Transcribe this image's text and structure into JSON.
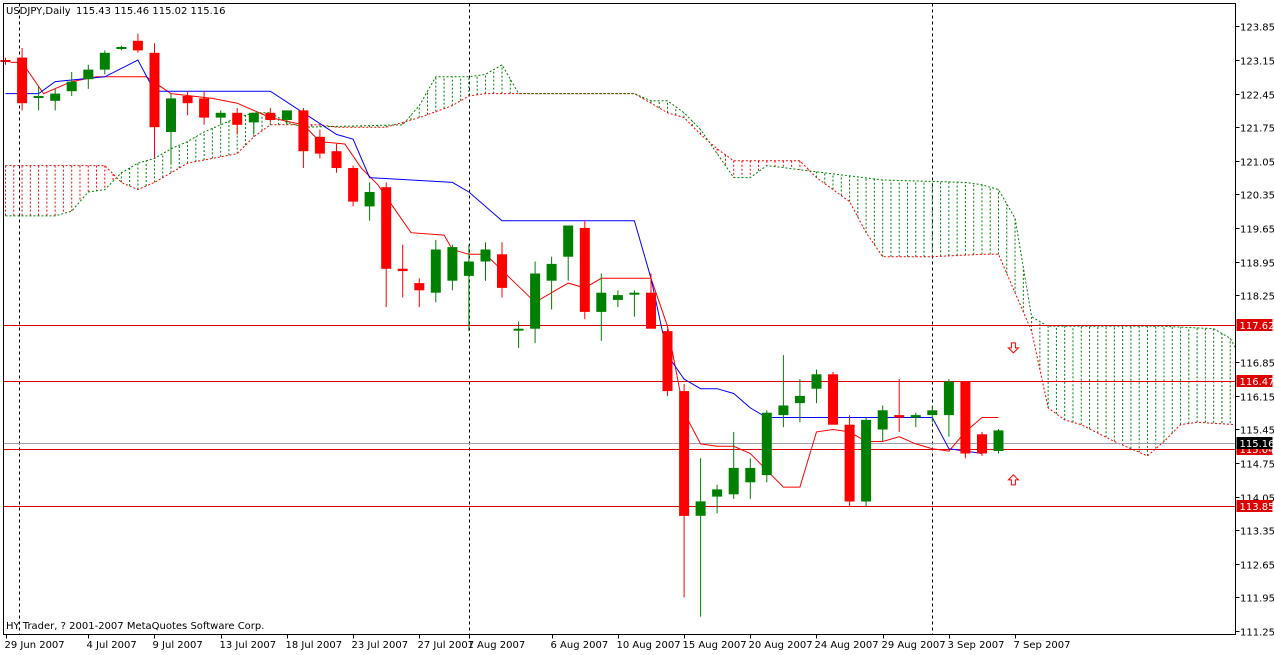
{
  "window": {
    "title_symbol": "USDJPY,Daily",
    "title_ohlc": "115.43 115.46 115.02 115.16",
    "copyright": "HY Trader, ? 2001-2007 MetaQuotes Software Corp."
  },
  "colors": {
    "background": "#ffffff",
    "bull_candle": "#008000",
    "bear_candle": "#ff0000",
    "tenkan": "#ff0000",
    "kijun": "#0000ff",
    "cloud_span_a": "#ff0000",
    "cloud_span_b": "#008000",
    "level_line": "#dd0000",
    "bid_line": "#a0a0b4",
    "price_tag_bg": "#dd0000",
    "bid_tag_bg": "#000000"
  },
  "chart_data": {
    "type": "candlestick",
    "symbol": "USDJPY",
    "timeframe": "Daily",
    "ylim": [
      111.1,
      124.15
    ],
    "y_ticks": [
      "123.85",
      "123.15",
      "122.45",
      "121.75",
      "121.05",
      "120.35",
      "119.65",
      "118.95",
      "118.25",
      "116.85",
      "116.15",
      "115.45",
      "114.75",
      "114.05",
      "113.35",
      "112.65",
      "111.95",
      "111.25"
    ],
    "x_tick_labels": [
      {
        "label": "29 Jun 2007",
        "bar": 0
      },
      {
        "label": "4 Jul 2007",
        "bar": 5
      },
      {
        "label": "9 Jul 2007",
        "bar": 9
      },
      {
        "label": "13 Jul 2007",
        "bar": 13
      },
      {
        "label": "18 Jul 2007",
        "bar": 17
      },
      {
        "label": "23 Jul 2007",
        "bar": 21
      },
      {
        "label": "27 Jul 2007",
        "bar": 25
      },
      {
        "label": "1 Aug 2007",
        "bar": 28
      },
      {
        "label": "6 Aug 2007",
        "bar": 33
      },
      {
        "label": "10 Aug 2007",
        "bar": 37
      },
      {
        "label": "15 Aug 2007",
        "bar": 41
      },
      {
        "label": "20 Aug 2007",
        "bar": 45
      },
      {
        "label": "24 Aug 2007",
        "bar": 49
      },
      {
        "label": "29 Aug 2007",
        "bar": 53
      },
      {
        "label": "3 Sep 2007",
        "bar": 57
      },
      {
        "label": "7 Sep 2007",
        "bar": 61
      }
    ],
    "period_separators_bar": [
      0.8,
      28,
      56
    ],
    "candles": [
      {
        "o": 123.15,
        "h": 123.2,
        "l": 123.05,
        "c": 123.12
      },
      {
        "o": 123.2,
        "h": 123.4,
        "l": 122.1,
        "c": 122.25
      },
      {
        "o": 122.4,
        "h": 122.6,
        "l": 122.1,
        "c": 122.4
      },
      {
        "o": 122.3,
        "h": 122.55,
        "l": 122.1,
        "c": 122.45
      },
      {
        "o": 122.5,
        "h": 122.9,
        "l": 122.4,
        "c": 122.7
      },
      {
        "o": 122.75,
        "h": 123.05,
        "l": 122.55,
        "c": 122.95
      },
      {
        "o": 122.95,
        "h": 123.35,
        "l": 122.85,
        "c": 123.3
      },
      {
        "o": 123.4,
        "h": 123.45,
        "l": 123.35,
        "c": 123.42
      },
      {
        "o": 123.55,
        "h": 123.7,
        "l": 123.3,
        "c": 123.35
      },
      {
        "o": 123.3,
        "h": 123.5,
        "l": 121.1,
        "c": 121.75
      },
      {
        "o": 121.65,
        "h": 122.45,
        "l": 121.0,
        "c": 122.35
      },
      {
        "o": 122.4,
        "h": 122.5,
        "l": 122.0,
        "c": 122.25
      },
      {
        "o": 122.35,
        "h": 122.5,
        "l": 121.8,
        "c": 121.95
      },
      {
        "o": 121.95,
        "h": 122.1,
        "l": 121.8,
        "c": 122.05
      },
      {
        "o": 122.05,
        "h": 122.15,
        "l": 121.6,
        "c": 121.8
      },
      {
        "o": 121.85,
        "h": 122.05,
        "l": 121.6,
        "c": 122.05
      },
      {
        "o": 122.05,
        "h": 122.15,
        "l": 121.85,
        "c": 121.9
      },
      {
        "o": 121.9,
        "h": 122.1,
        "l": 121.8,
        "c": 122.1
      },
      {
        "o": 122.1,
        "h": 122.15,
        "l": 120.9,
        "c": 121.25
      },
      {
        "o": 121.55,
        "h": 121.7,
        "l": 121.1,
        "c": 121.2
      },
      {
        "o": 121.25,
        "h": 121.4,
        "l": 120.8,
        "c": 120.9
      },
      {
        "o": 120.9,
        "h": 120.95,
        "l": 120.1,
        "c": 120.2
      },
      {
        "o": 120.1,
        "h": 120.6,
        "l": 119.8,
        "c": 120.4
      },
      {
        "o": 120.5,
        "h": 120.6,
        "l": 118.0,
        "c": 118.8
      },
      {
        "o": 118.8,
        "h": 119.3,
        "l": 118.2,
        "c": 118.75
      },
      {
        "o": 118.5,
        "h": 118.6,
        "l": 118.0,
        "c": 118.35
      },
      {
        "o": 118.3,
        "h": 119.4,
        "l": 118.1,
        "c": 119.2
      },
      {
        "o": 118.55,
        "h": 119.3,
        "l": 118.35,
        "c": 119.25
      },
      {
        "o": 118.65,
        "h": 119.3,
        "l": 117.5,
        "c": 118.95
      },
      {
        "o": 118.95,
        "h": 119.35,
        "l": 118.55,
        "c": 119.2
      },
      {
        "o": 119.1,
        "h": 119.35,
        "l": 118.2,
        "c": 118.4
      },
      {
        "o": 117.55,
        "h": 117.7,
        "l": 117.15,
        "c": 117.55
      },
      {
        "o": 117.55,
        "h": 118.95,
        "l": 117.25,
        "c": 118.7
      },
      {
        "o": 118.55,
        "h": 119.05,
        "l": 117.95,
        "c": 118.9
      },
      {
        "o": 119.05,
        "h": 119.7,
        "l": 118.55,
        "c": 119.7
      },
      {
        "o": 119.65,
        "h": 119.8,
        "l": 117.75,
        "c": 117.9
      },
      {
        "o": 117.9,
        "h": 118.7,
        "l": 117.3,
        "c": 118.3
      },
      {
        "o": 118.15,
        "h": 118.35,
        "l": 118.0,
        "c": 118.25
      },
      {
        "o": 118.3,
        "h": 118.35,
        "l": 117.8,
        "c": 118.3
      },
      {
        "o": 118.3,
        "h": 118.7,
        "l": 117.6,
        "c": 117.55
      },
      {
        "o": 117.5,
        "h": 117.55,
        "l": 116.15,
        "c": 116.25
      },
      {
        "o": 116.25,
        "h": 116.4,
        "l": 111.95,
        "c": 113.65
      },
      {
        "o": 113.65,
        "h": 114.85,
        "l": 111.55,
        "c": 113.95
      },
      {
        "o": 114.05,
        "h": 114.3,
        "l": 113.7,
        "c": 114.2
      },
      {
        "o": 114.1,
        "h": 115.4,
        "l": 114.0,
        "c": 114.65
      },
      {
        "o": 114.35,
        "h": 114.85,
        "l": 114.0,
        "c": 114.65
      },
      {
        "o": 114.5,
        "h": 115.85,
        "l": 114.35,
        "c": 115.8
      },
      {
        "o": 115.75,
        "h": 117.0,
        "l": 115.5,
        "c": 115.95
      },
      {
        "o": 116.0,
        "h": 116.5,
        "l": 115.6,
        "c": 116.15
      },
      {
        "o": 116.3,
        "h": 116.7,
        "l": 116.0,
        "c": 116.6
      },
      {
        "o": 116.6,
        "h": 116.65,
        "l": 115.6,
        "c": 115.55
      },
      {
        "o": 115.55,
        "h": 115.75,
        "l": 113.85,
        "c": 113.95
      },
      {
        "o": 113.95,
        "h": 115.7,
        "l": 113.85,
        "c": 115.65
      },
      {
        "o": 115.45,
        "h": 115.95,
        "l": 115.2,
        "c": 115.85
      },
      {
        "o": 115.75,
        "h": 116.5,
        "l": 115.4,
        "c": 115.7
      },
      {
        "o": 115.7,
        "h": 115.8,
        "l": 115.5,
        "c": 115.75
      },
      {
        "o": 115.75,
        "h": 115.95,
        "l": 115.6,
        "c": 115.85
      },
      {
        "o": 115.75,
        "h": 116.5,
        "l": 115.3,
        "c": 116.45
      },
      {
        "o": 116.45,
        "h": 116.45,
        "l": 114.85,
        "c": 114.95
      },
      {
        "o": 115.35,
        "h": 115.4,
        "l": 114.9,
        "c": 114.95
      },
      {
        "o": 115.0,
        "h": 115.46,
        "l": 114.95,
        "c": 115.43
      }
    ],
    "tenkan": [
      [
        0.3,
        123.1
      ],
      [
        1,
        123.1
      ],
      [
        2.3,
        122.45
      ],
      [
        4,
        122.7
      ],
      [
        5.5,
        122.8
      ],
      [
        8.5,
        122.8
      ],
      [
        10,
        122.45
      ],
      [
        12.5,
        122.35
      ],
      [
        14,
        122.25
      ],
      [
        16,
        121.95
      ],
      [
        18,
        121.8
      ],
      [
        19,
        121.45
      ],
      [
        20.5,
        121.4
      ],
      [
        21.5,
        120.9
      ],
      [
        22.5,
        120.55
      ],
      [
        23.5,
        120.05
      ],
      [
        24.5,
        119.55
      ],
      [
        26.5,
        119.5
      ],
      [
        27,
        119.2
      ],
      [
        28,
        119.1
      ],
      [
        29,
        119.1
      ],
      [
        30.5,
        118.6
      ],
      [
        32,
        118.1
      ],
      [
        33,
        118.3
      ],
      [
        34,
        118.5
      ],
      [
        35,
        118.4
      ],
      [
        36,
        118.6
      ],
      [
        38,
        118.6
      ],
      [
        39,
        118.6
      ],
      [
        40,
        117.6
      ],
      [
        41,
        115.8
      ],
      [
        42,
        115.15
      ],
      [
        43,
        115.1
      ],
      [
        44,
        115.1
      ],
      [
        45,
        114.95
      ],
      [
        46,
        114.6
      ],
      [
        47,
        114.25
      ],
      [
        48,
        114.25
      ],
      [
        49,
        115.4
      ],
      [
        50,
        115.45
      ],
      [
        51,
        115.4
      ],
      [
        52,
        115.2
      ],
      [
        53,
        115.2
      ],
      [
        54,
        115.3
      ],
      [
        55,
        115.15
      ],
      [
        56,
        115.05
      ],
      [
        57,
        115.0
      ],
      [
        58,
        115.4
      ],
      [
        59,
        115.7
      ],
      [
        60,
        115.7
      ]
    ],
    "kijun": [
      [
        0,
        122.45
      ],
      [
        2,
        122.45
      ],
      [
        3,
        122.7
      ],
      [
        6,
        122.8
      ],
      [
        8,
        123.15
      ],
      [
        9,
        122.5
      ],
      [
        16,
        122.5
      ],
      [
        18,
        122.05
      ],
      [
        20,
        121.6
      ],
      [
        21,
        121.5
      ],
      [
        22,
        120.7
      ],
      [
        27,
        120.6
      ],
      [
        28,
        120.4
      ],
      [
        30,
        119.8
      ],
      [
        33,
        119.8
      ],
      [
        34,
        119.8
      ],
      [
        38,
        119.8
      ],
      [
        39,
        118.6
      ],
      [
        40,
        117.0
      ],
      [
        41,
        116.5
      ],
      [
        42,
        116.3
      ],
      [
        43,
        116.3
      ],
      [
        44,
        116.2
      ],
      [
        45,
        115.9
      ],
      [
        46,
        115.7
      ],
      [
        53,
        115.7
      ],
      [
        56,
        115.7
      ],
      [
        57,
        115.05
      ],
      [
        58,
        115.0
      ],
      [
        59,
        114.95
      ]
    ],
    "senkou_a": [
      [
        0,
        120.95
      ],
      [
        6,
        120.95
      ],
      [
        7,
        120.6
      ],
      [
        8,
        120.45
      ],
      [
        9,
        120.6
      ],
      [
        10,
        120.8
      ],
      [
        11,
        121.0
      ],
      [
        14,
        121.2
      ],
      [
        15,
        121.55
      ],
      [
        16,
        121.8
      ],
      [
        19,
        121.8
      ],
      [
        20,
        121.75
      ],
      [
        23,
        121.75
      ],
      [
        24,
        121.85
      ],
      [
        25,
        121.95
      ],
      [
        27,
        122.2
      ],
      [
        28,
        122.4
      ],
      [
        29,
        122.45
      ],
      [
        38,
        122.45
      ],
      [
        39,
        122.25
      ],
      [
        40,
        122.05
      ],
      [
        41,
        121.95
      ],
      [
        42,
        121.6
      ],
      [
        43,
        121.3
      ],
      [
        44,
        121.05
      ],
      [
        45,
        121.05
      ],
      [
        48,
        121.05
      ],
      [
        49,
        120.7
      ],
      [
        50,
        120.45
      ],
      [
        51,
        120.2
      ],
      [
        52,
        119.55
      ],
      [
        53,
        119.05
      ],
      [
        56,
        119.05
      ],
      [
        59,
        119.1
      ],
      [
        60,
        119.1
      ],
      [
        62,
        117.5
      ],
      [
        63,
        115.9
      ],
      [
        64,
        115.65
      ],
      [
        65,
        115.55
      ],
      [
        67,
        115.2
      ],
      [
        69,
        114.9
      ],
      [
        70,
        115.2
      ],
      [
        71,
        115.55
      ],
      [
        72,
        115.6
      ],
      [
        77,
        115.55
      ]
    ],
    "senkou_b": [
      [
        0,
        119.9
      ],
      [
        3,
        119.9
      ],
      [
        4,
        120.0
      ],
      [
        5,
        120.4
      ],
      [
        6,
        120.45
      ],
      [
        7,
        120.8
      ],
      [
        8,
        121.0
      ],
      [
        9,
        121.1
      ],
      [
        10,
        121.3
      ],
      [
        11,
        121.45
      ],
      [
        12,
        121.65
      ],
      [
        13,
        121.8
      ],
      [
        14,
        121.95
      ],
      [
        15,
        122.05
      ],
      [
        16,
        122.05
      ],
      [
        17,
        121.85
      ],
      [
        18,
        121.75
      ],
      [
        24,
        121.8
      ],
      [
        25,
        122.2
      ],
      [
        26,
        122.8
      ],
      [
        27,
        122.8
      ],
      [
        28,
        122.8
      ],
      [
        29,
        122.85
      ],
      [
        30,
        123.05
      ],
      [
        31,
        122.45
      ],
      [
        38,
        122.45
      ],
      [
        39,
        122.3
      ],
      [
        40,
        122.3
      ],
      [
        41,
        122.05
      ],
      [
        42,
        121.7
      ],
      [
        43,
        121.2
      ],
      [
        44,
        120.7
      ],
      [
        45,
        120.7
      ],
      [
        46,
        120.95
      ],
      [
        53,
        120.65
      ],
      [
        58,
        120.6
      ],
      [
        59,
        120.55
      ],
      [
        60,
        120.45
      ],
      [
        61,
        119.85
      ],
      [
        62,
        117.8
      ],
      [
        63,
        117.6
      ],
      [
        70,
        117.6
      ],
      [
        73,
        117.55
      ],
      [
        74,
        117.35
      ],
      [
        75,
        117.15
      ],
      [
        77,
        117.15
      ]
    ],
    "horizontal_levels": [
      {
        "value": 117.62,
        "label": "117.62"
      },
      {
        "value": 116.47,
        "label": "116.47"
      },
      {
        "value": 115.04,
        "label": "115.04"
      },
      {
        "value": 113.85,
        "label": "113.85"
      }
    ],
    "bid": {
      "value": 115.16,
      "label": "115.16"
    },
    "arrows": [
      {
        "type": "down",
        "bar": 60.9,
        "value": 117.15
      },
      {
        "type": "up",
        "bar": 60.9,
        "value": 114.4
      }
    ]
  }
}
